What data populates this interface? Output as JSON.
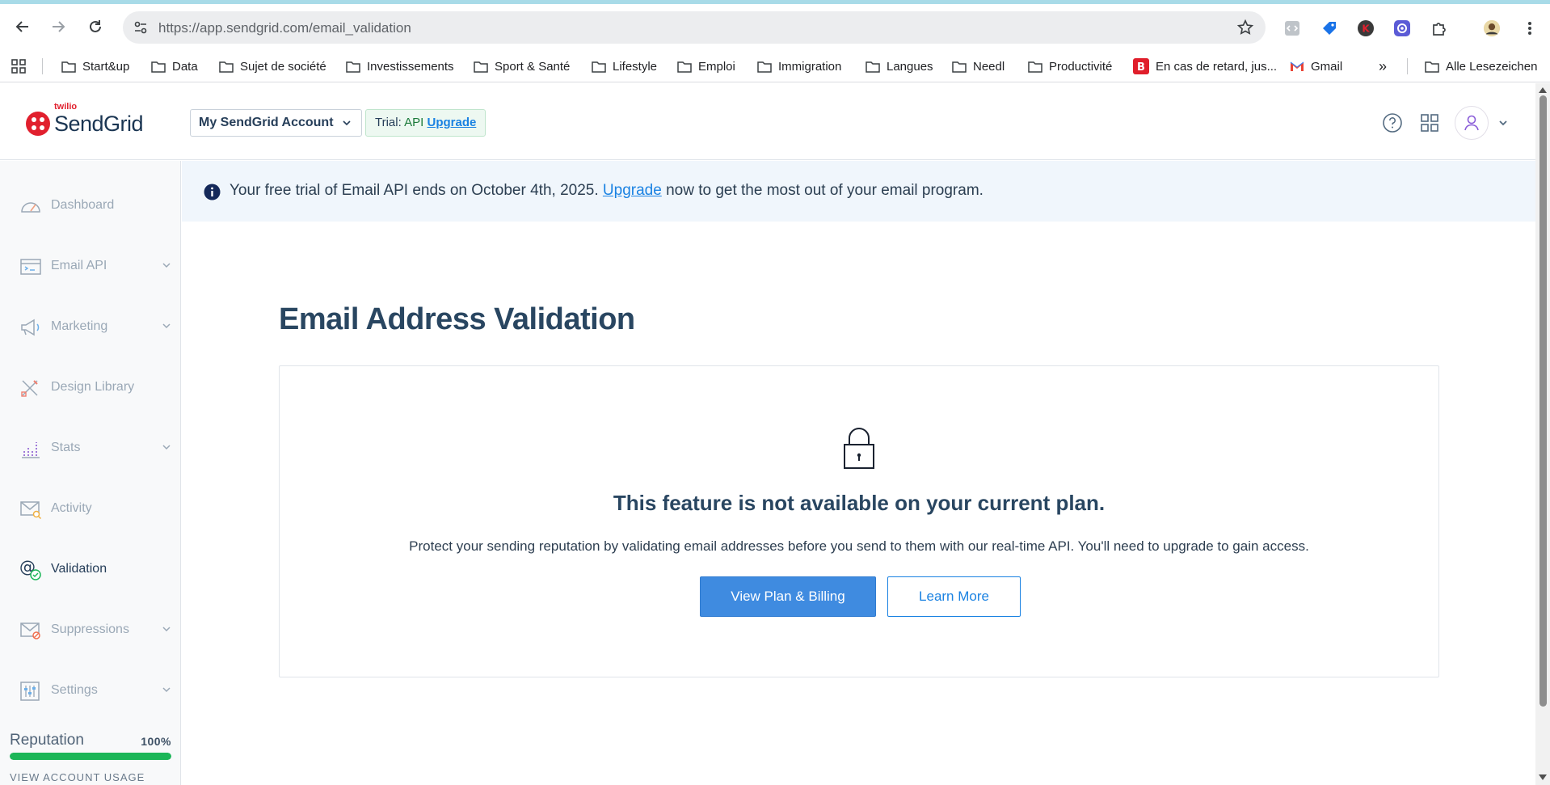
{
  "browser": {
    "url": "https://app.sendgrid.com/email_validation",
    "bookmarks": [
      {
        "label": "Start&up",
        "icon": "folder-icon"
      },
      {
        "label": "Data",
        "icon": "folder-icon"
      },
      {
        "label": "Sujet de société",
        "icon": "folder-icon"
      },
      {
        "label": "Investissements",
        "icon": "folder-icon"
      },
      {
        "label": "Sport & Santé",
        "icon": "folder-icon"
      },
      {
        "label": "Lifestyle",
        "icon": "folder-icon"
      },
      {
        "label": "Emploi",
        "icon": "folder-icon"
      },
      {
        "label": "Immigration",
        "icon": "folder-icon"
      },
      {
        "label": "Langues",
        "icon": "folder-icon"
      },
      {
        "label": "Needl",
        "icon": "folder-icon"
      },
      {
        "label": "Productivité",
        "icon": "folder-icon"
      },
      {
        "label": "En cas de retard, jus...",
        "icon": "b-favicon"
      },
      {
        "label": "Gmail",
        "icon": "gmail-icon"
      }
    ],
    "all_bookmarks": "Alle Lesezeichen",
    "overflow": "»"
  },
  "header": {
    "logo_small": "twilio",
    "logo_main": "SendGrid",
    "account": "My SendGrid Account",
    "trial_prefix": "Trial:",
    "trial_plan": "API",
    "trial_upgrade": "Upgrade"
  },
  "sidebar": {
    "items": [
      {
        "label": "Dashboard"
      },
      {
        "label": "Email API"
      },
      {
        "label": "Marketing"
      },
      {
        "label": "Design Library"
      },
      {
        "label": "Stats"
      },
      {
        "label": "Activity"
      },
      {
        "label": "Validation"
      },
      {
        "label": "Suppressions"
      },
      {
        "label": "Settings"
      }
    ],
    "reputation_label": "Reputation",
    "reputation_value": "100%",
    "reputation_fraction": 1.0,
    "usage_link": "VIEW ACCOUNT USAGE"
  },
  "banner": {
    "text_before": "Your free trial of Email API ends on October 4th, 2025.",
    "link": "Upgrade",
    "text_after": "now to get the most out of your email program."
  },
  "main": {
    "title": "Email Address Validation",
    "card_heading": "This feature is not available on your current plan.",
    "card_text": "Protect your sending reputation by validating email addresses before you send to them with our real-time API. You'll need to upgrade to gain access.",
    "primary_button": "View Plan & Billing",
    "secondary_button": "Learn More"
  },
  "colors": {
    "accent": "#1a82e2",
    "primary_button": "#3f8be0",
    "brand_red": "#e1202e",
    "reputation_green": "#1bb657"
  }
}
